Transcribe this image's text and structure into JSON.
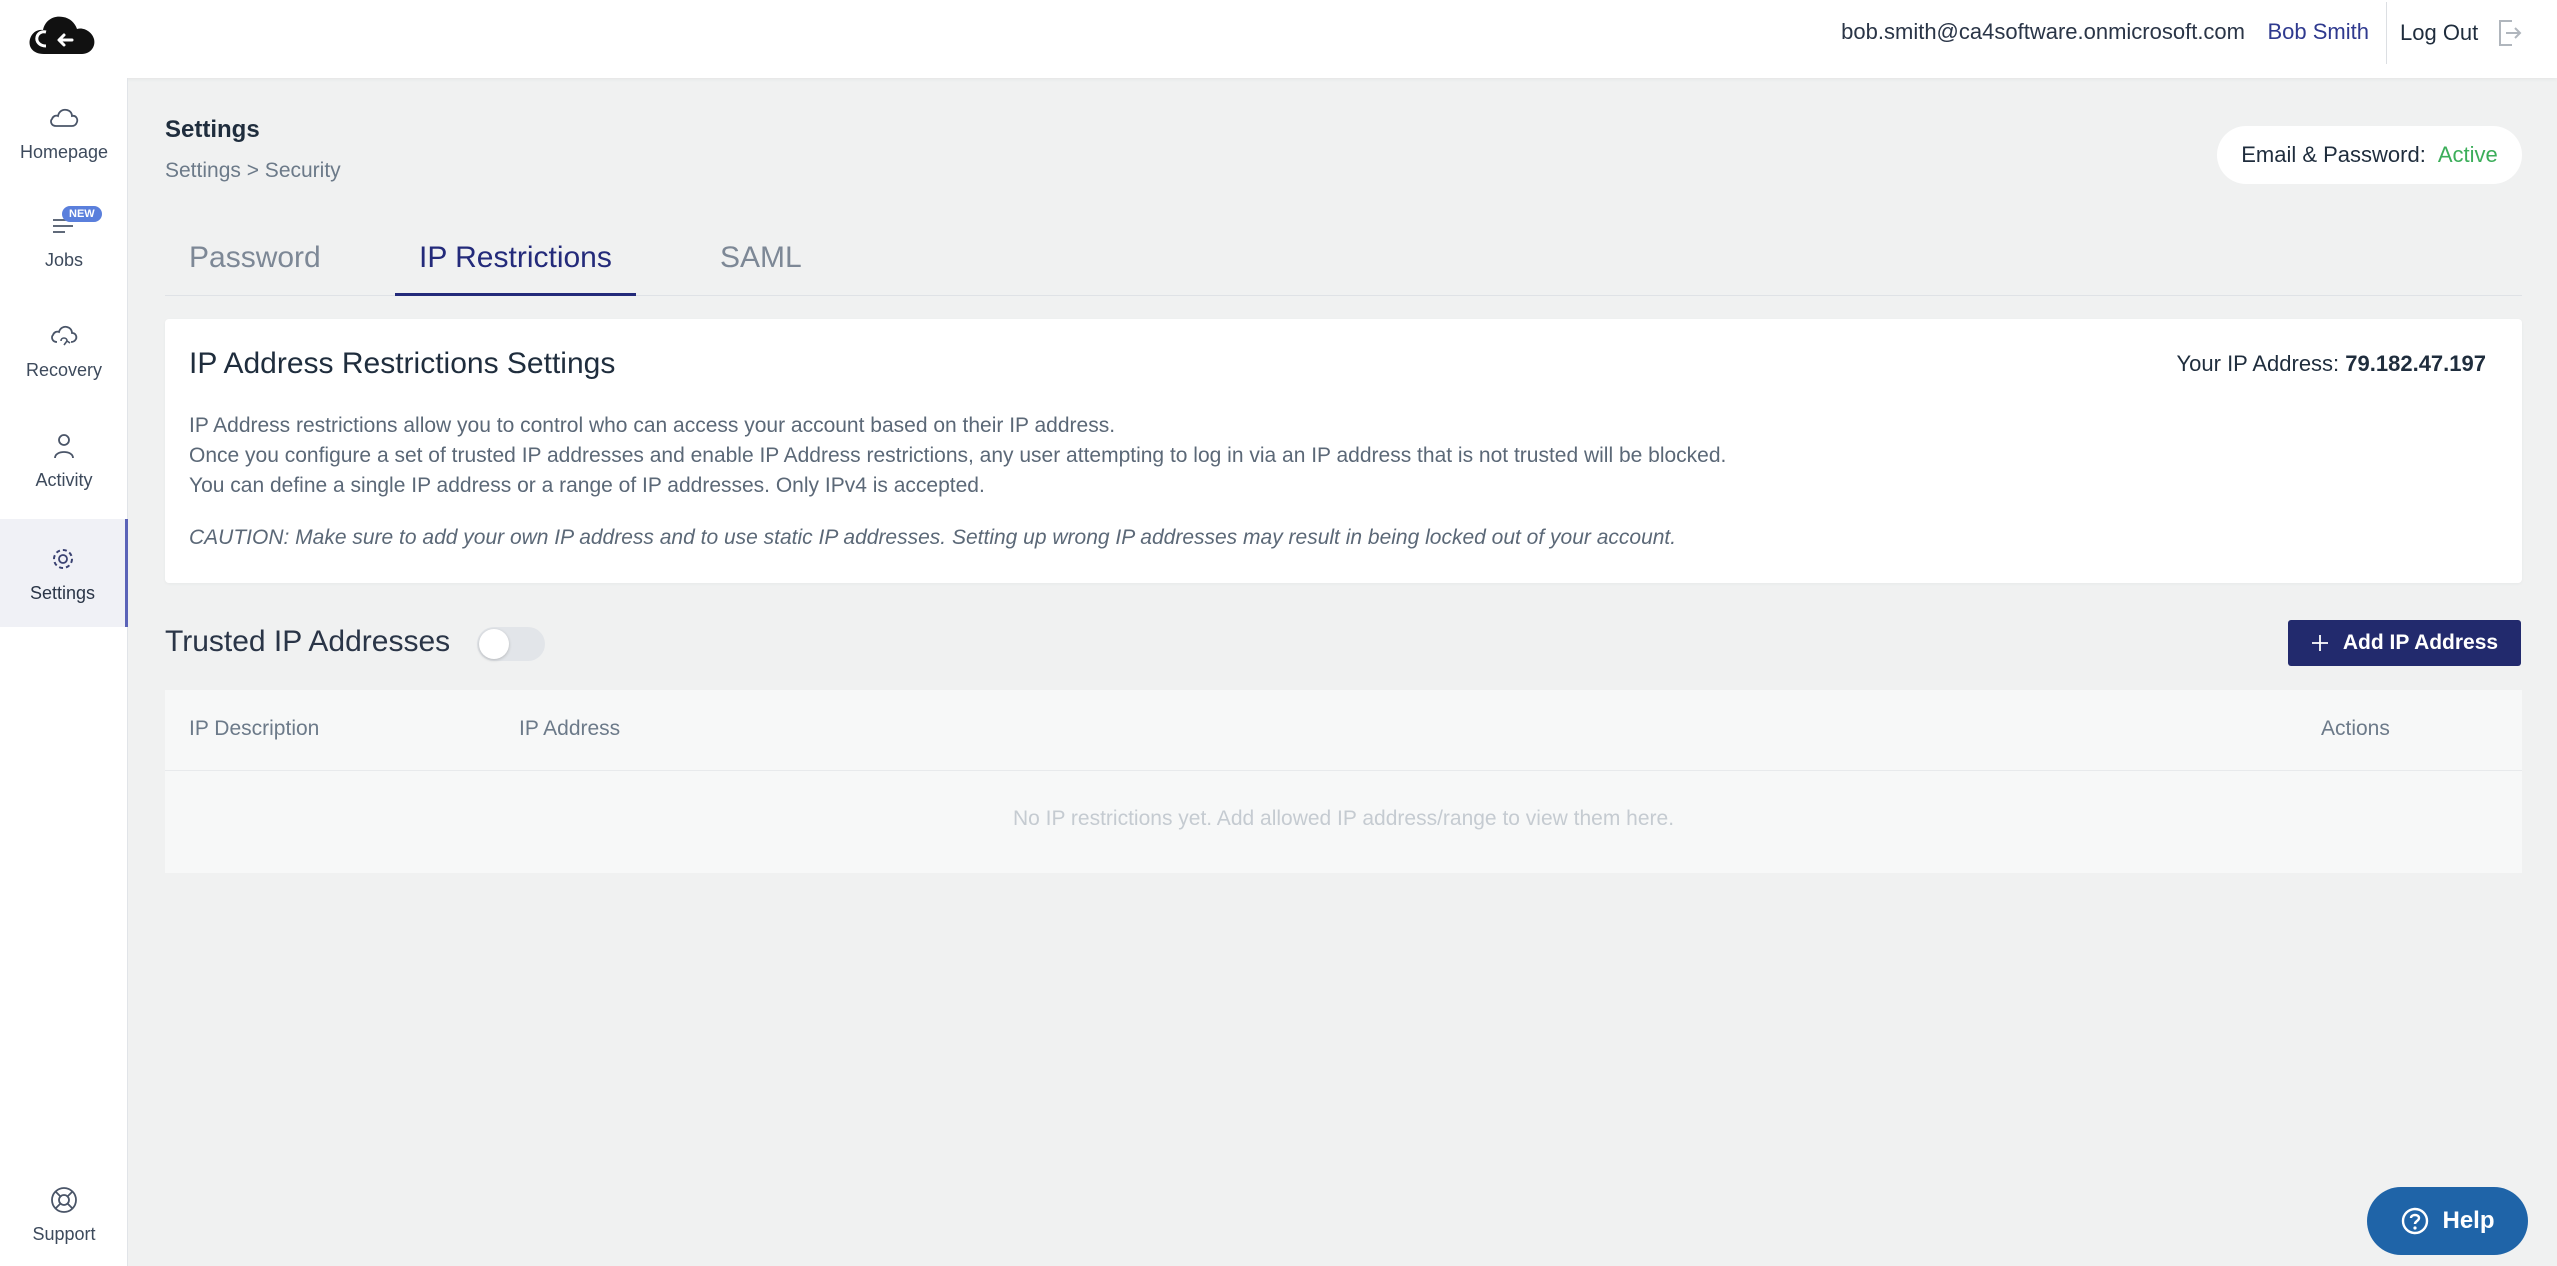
{
  "header": {
    "email": "bob.smith@ca4software.onmicrosoft.com",
    "user_name": "Bob Smith",
    "logout_label": "Log Out"
  },
  "sidebar": {
    "items": [
      {
        "label": "Homepage",
        "icon": "cloud-icon"
      },
      {
        "label": "Jobs",
        "icon": "list-icon",
        "badge": "NEW"
      },
      {
        "label": "Recovery",
        "icon": "recovery-icon"
      },
      {
        "label": "Activity",
        "icon": "user-icon"
      },
      {
        "label": "Settings",
        "icon": "gear-icon",
        "active": true
      }
    ],
    "support_label": "Support"
  },
  "page": {
    "title": "Settings",
    "breadcrumb": "Settings > Security",
    "status_label": "Email & Password:",
    "status_value": "Active"
  },
  "tabs": [
    {
      "label": "Password"
    },
    {
      "label": "IP Restrictions",
      "active": true
    },
    {
      "label": "SAML"
    }
  ],
  "card": {
    "title": "IP Address Restrictions Settings",
    "ip_label": "Your IP Address:",
    "ip_value": "79.182.47.197",
    "desc_1": "IP Address restrictions allow you to control who can access your account based on their IP address.",
    "desc_2": "Once you configure a set of trusted IP addresses and enable IP Address restrictions, any user attempting to log in via an IP address that is not trusted will be blocked.",
    "desc_3": "You can define a single IP address or a range of IP addresses. Only IPv4 is accepted.",
    "caution": "CAUTION: Make sure to add your own IP address and to use static IP addresses. Setting up wrong IP addresses may result in being locked out of your account."
  },
  "trusted": {
    "title": "Trusted IP Addresses",
    "enabled": false,
    "add_button": "Add IP Address"
  },
  "table": {
    "columns": [
      "IP Description",
      "IP Address",
      "Actions"
    ],
    "empty_message": "No IP restrictions yet. Add allowed IP address/range to view them here."
  },
  "help_label": "Help",
  "colors": {
    "accent": "#222a6d",
    "active_status": "#3cae5a",
    "help": "#1f64a8",
    "badge": "#5a7fdc"
  }
}
